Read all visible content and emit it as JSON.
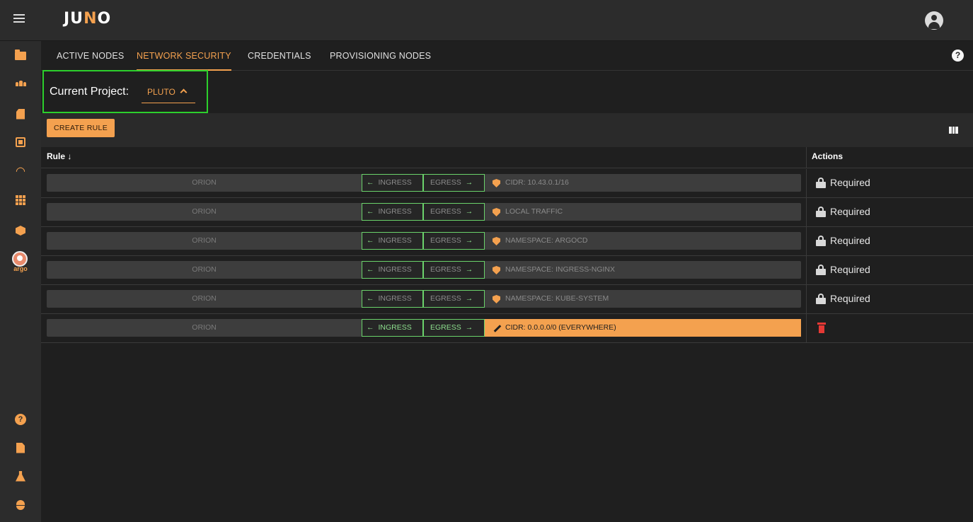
{
  "app": {
    "logo": "JUNO",
    "logo_left": "JU",
    "logo_mid": "N",
    "logo_right": "O"
  },
  "sidebar": {
    "items": [
      {
        "icon": "folder-icon"
      },
      {
        "icon": "people-icon"
      },
      {
        "icon": "sd-card-icon"
      },
      {
        "icon": "chip-icon"
      },
      {
        "icon": "wifi-icon"
      },
      {
        "icon": "apps-grid-icon"
      },
      {
        "icon": "cube-icon"
      },
      {
        "icon": "argo-logo-icon",
        "label": "argo"
      }
    ],
    "bottom_items": [
      {
        "icon": "help-icon",
        "glyph": "?"
      },
      {
        "icon": "document-icon"
      },
      {
        "icon": "flask-icon"
      },
      {
        "icon": "bug-icon"
      }
    ]
  },
  "tabs": [
    {
      "label": "ACTIVE NODES",
      "active": false
    },
    {
      "label": "NETWORK SECURITY",
      "active": true
    },
    {
      "label": "CREDENTIALS",
      "active": false
    },
    {
      "label": "PROVISIONING NODES",
      "active": false
    }
  ],
  "help_glyph": "?",
  "project": {
    "label": "Current Project:",
    "value": "PLUTO"
  },
  "toolbar": {
    "create_label": "CREATE RULE"
  },
  "table": {
    "col_rule": "Rule",
    "sort_glyph": "↓",
    "col_actions": "Actions",
    "ingress_arrow": "←",
    "egress_arrow": "→",
    "rows": [
      {
        "source": "ORION",
        "ingress": "INGRESS",
        "egress": "EGRESS",
        "destination": "CIDR: 10.43.0.1/16",
        "action": "Required",
        "editable": false
      },
      {
        "source": "ORION",
        "ingress": "INGRESS",
        "egress": "EGRESS",
        "destination": "LOCAL TRAFFIC",
        "action": "Required",
        "editable": false
      },
      {
        "source": "ORION",
        "ingress": "INGRESS",
        "egress": "EGRESS",
        "destination": "NAMESPACE: ARGOCD",
        "action": "Required",
        "editable": false
      },
      {
        "source": "ORION",
        "ingress": "INGRESS",
        "egress": "EGRESS",
        "destination": "NAMESPACE: INGRESS-NGINX",
        "action": "Required",
        "editable": false
      },
      {
        "source": "ORION",
        "ingress": "INGRESS",
        "egress": "EGRESS",
        "destination": "NAMESPACE: KUBE-SYSTEM",
        "action": "Required",
        "editable": false
      },
      {
        "source": "ORION",
        "ingress": "INGRESS",
        "egress": "EGRESS",
        "destination": "CIDR: 0.0.0.0/0 (EVERYWHERE)",
        "action": "delete",
        "editable": true
      }
    ]
  },
  "colors": {
    "accent": "#f4a14f",
    "highlight_border": "#2ccf2c",
    "ingress_green": "#8ee08e",
    "delete_red": "#e53935"
  }
}
